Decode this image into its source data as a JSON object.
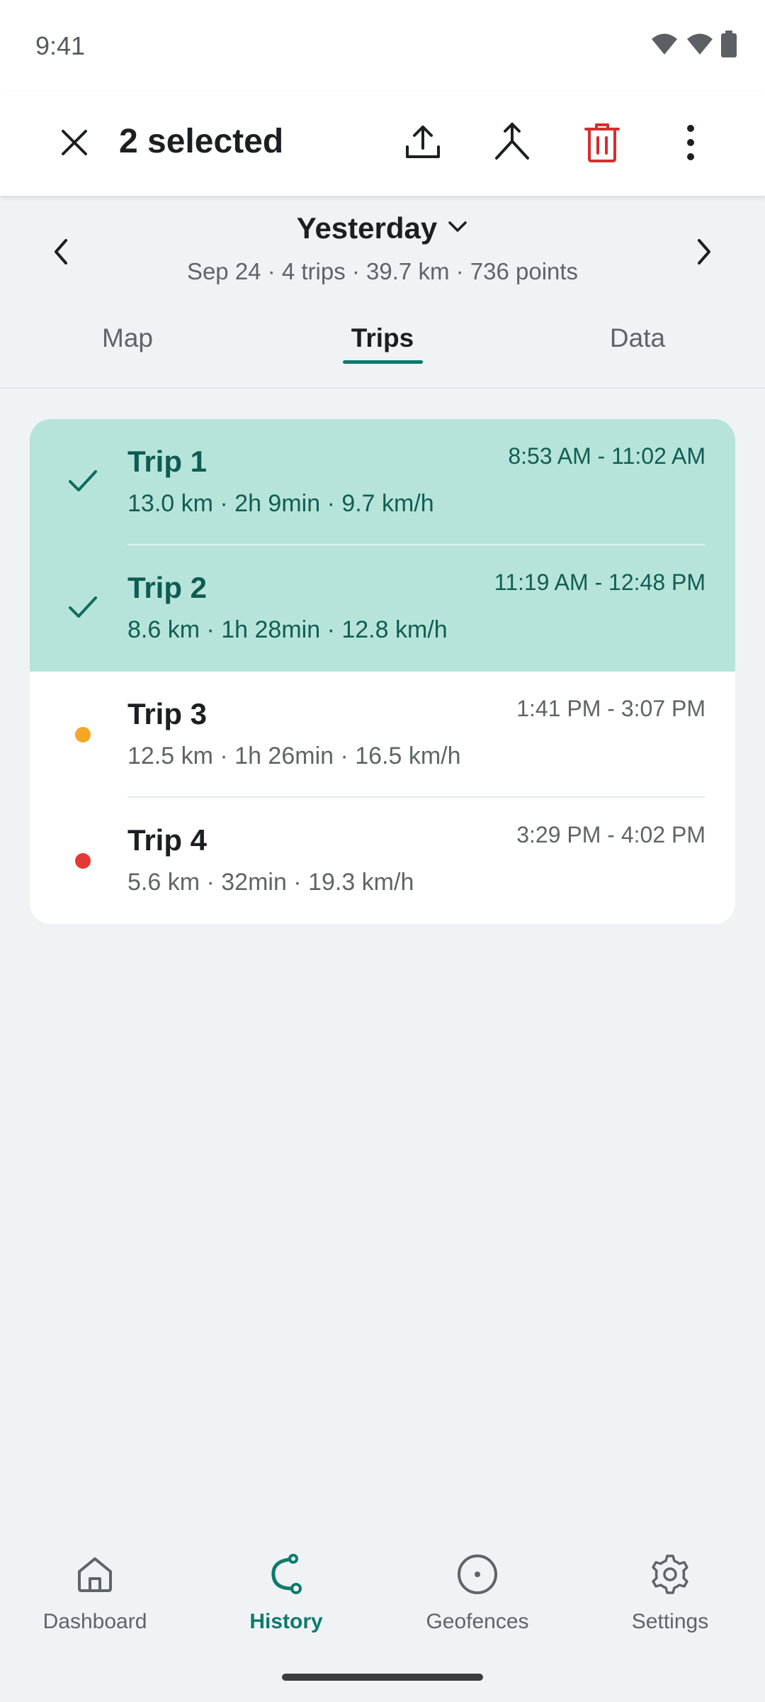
{
  "status_bar": {
    "time": "9:41"
  },
  "app_bar": {
    "title": "2 selected",
    "actions": [
      "close-icon",
      "upload-icon",
      "merge-icon",
      "delete-icon",
      "more-vert-icon"
    ],
    "delete_color": "#d32f2f"
  },
  "date_header": {
    "title": "Yesterday",
    "subtitle": "Sep 24 · 4 trips · 39.7 km · 736 points"
  },
  "tabs": [
    {
      "label": "Map",
      "active": false
    },
    {
      "label": "Trips",
      "active": true
    },
    {
      "label": "Data",
      "active": false
    }
  ],
  "trips": [
    {
      "name": "Trip 1",
      "stats": "13.0 km · 2h 9min · 9.7 km/h",
      "time": "8:53 AM - 11:02 AM",
      "selected": true,
      "marker_color": ""
    },
    {
      "name": "Trip 2",
      "stats": "8.6 km · 1h 28min · 12.8 km/h",
      "time": "11:19 AM - 12:48 PM",
      "selected": true,
      "marker_color": ""
    },
    {
      "name": "Trip 3",
      "stats": "12.5 km · 1h 26min · 16.5 km/h",
      "time": "1:41 PM - 3:07 PM",
      "selected": false,
      "marker_color": "#f5a623"
    },
    {
      "name": "Trip 4",
      "stats": "5.6 km · 32min · 19.3 km/h",
      "time": "3:29 PM - 4:02 PM",
      "selected": false,
      "marker_color": "#e53935"
    }
  ],
  "bottom_nav": [
    {
      "label": "Dashboard",
      "icon": "home-icon",
      "active": false
    },
    {
      "label": "History",
      "icon": "history-route-icon",
      "active": true
    },
    {
      "label": "Geofences",
      "icon": "geofence-icon",
      "active": false
    },
    {
      "label": "Settings",
      "icon": "gear-icon",
      "active": false
    }
  ],
  "colors": {
    "accent": "#0f7a6c",
    "selected_row": "#b7e4da",
    "background": "#eff3f6"
  }
}
